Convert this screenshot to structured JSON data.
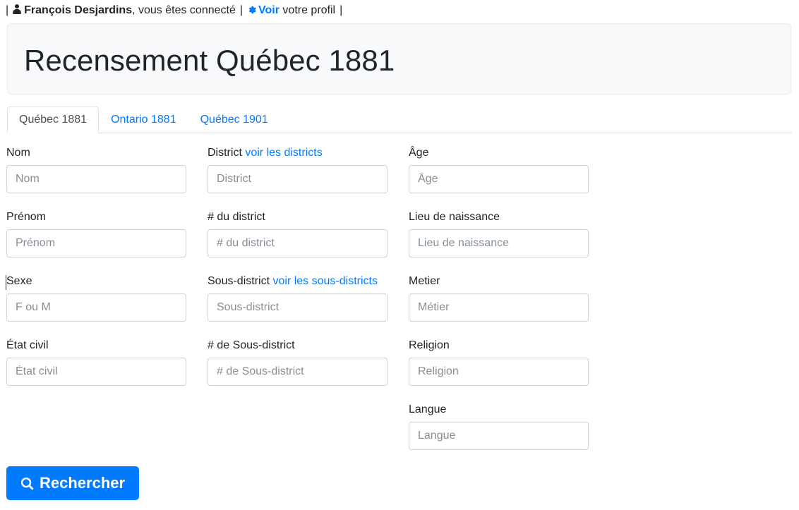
{
  "userbar": {
    "leading_pipe": "|",
    "user_icon": "user-icon",
    "username": "François Desjardins",
    "status_text": ", vous êtes connecté",
    "mid_pipe": "|",
    "gear_icon": "gear-icon",
    "profile_link": "Voir",
    "profile_text": " votre profil",
    "trailing_pipe": "|"
  },
  "header": {
    "title": "Recensement Québec 1881"
  },
  "tabs": [
    {
      "label": "Québec 1881",
      "active": true
    },
    {
      "label": "Ontario 1881",
      "active": false
    },
    {
      "label": "Québec 1901",
      "active": false
    }
  ],
  "form": {
    "col1": [
      {
        "label": "Nom",
        "placeholder": "Nom",
        "value": "",
        "name": "nom"
      },
      {
        "label": "Prénom",
        "placeholder": "Prénom",
        "value": "",
        "name": "prenom"
      },
      {
        "label": "Sexe",
        "placeholder": "F ou M",
        "value": "",
        "name": "sexe"
      },
      {
        "label": "État civil",
        "placeholder": "État civil",
        "value": "",
        "name": "etat-civil"
      }
    ],
    "col2": [
      {
        "label": "District",
        "link": "voir les districts",
        "placeholder": "District",
        "value": "",
        "name": "district"
      },
      {
        "label": "# du district",
        "link": "",
        "placeholder": "# du district",
        "value": "",
        "name": "numero-district"
      },
      {
        "label": "Sous-district",
        "link": "voir les sous-districts",
        "placeholder": "Sous-district",
        "value": "",
        "name": "sous-district"
      },
      {
        "label": "# de Sous-district",
        "link": "",
        "placeholder": "# de Sous-district",
        "value": "",
        "name": "numero-sous-district"
      }
    ],
    "col3": [
      {
        "label": "Âge",
        "placeholder": "Âge",
        "value": "",
        "name": "age"
      },
      {
        "label": "Lieu de naissance",
        "placeholder": "Lieu de naissance",
        "value": "",
        "name": "lieu-de-naissance"
      },
      {
        "label": "Metier",
        "placeholder": "Métier",
        "value": "",
        "name": "metier"
      },
      {
        "label": "Religion",
        "placeholder": "Religion",
        "value": "",
        "name": "religion"
      },
      {
        "label": "Langue",
        "placeholder": "Langue",
        "value": "",
        "name": "langue"
      }
    ]
  },
  "submit": {
    "label": "Rechercher",
    "icon": "search-icon"
  },
  "colors": {
    "accent": "#007bff",
    "jumbotron_bg": "#f8f9fa",
    "border": "#dee2e6",
    "input_border": "#ced4da",
    "text": "#212529",
    "placeholder": "#868e96"
  }
}
